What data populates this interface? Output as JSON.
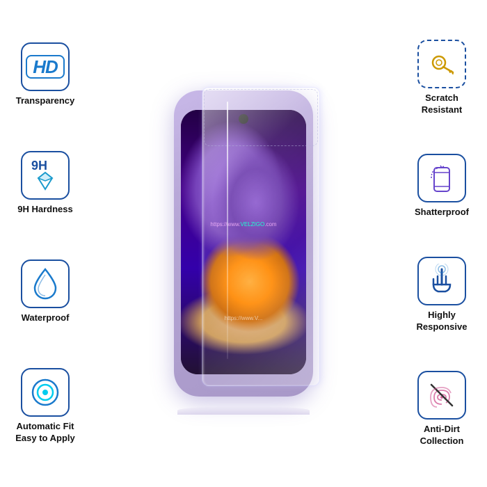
{
  "features": {
    "left": [
      {
        "id": "hd-transparency",
        "icon": "hd",
        "label": "Transparency"
      },
      {
        "id": "9h-hardness",
        "icon": "9h",
        "label": "9H Hardness"
      },
      {
        "id": "waterproof",
        "icon": "drop",
        "label": "Waterproof"
      },
      {
        "id": "auto-fit",
        "icon": "circle-target",
        "label": "Automatic Fit\nEasy to Apply"
      }
    ],
    "right": [
      {
        "id": "scratch-resistant",
        "icon": "key",
        "label": "Scratch\nResistant"
      },
      {
        "id": "shatterproof",
        "icon": "phone-rotate",
        "label": "Shatterproof"
      },
      {
        "id": "highly-responsive",
        "icon": "hand-touch",
        "label": "Highly\nResponsive"
      },
      {
        "id": "anti-dirt",
        "icon": "fingerprint-slash",
        "label": "Anti-Dirt\nCollection"
      }
    ]
  },
  "phone": {
    "watermark1": "https://www.VELZIGO.com",
    "watermark2": "https://www.V..."
  },
  "brand": {
    "watermark": "https://www.VELZIGO.com"
  }
}
